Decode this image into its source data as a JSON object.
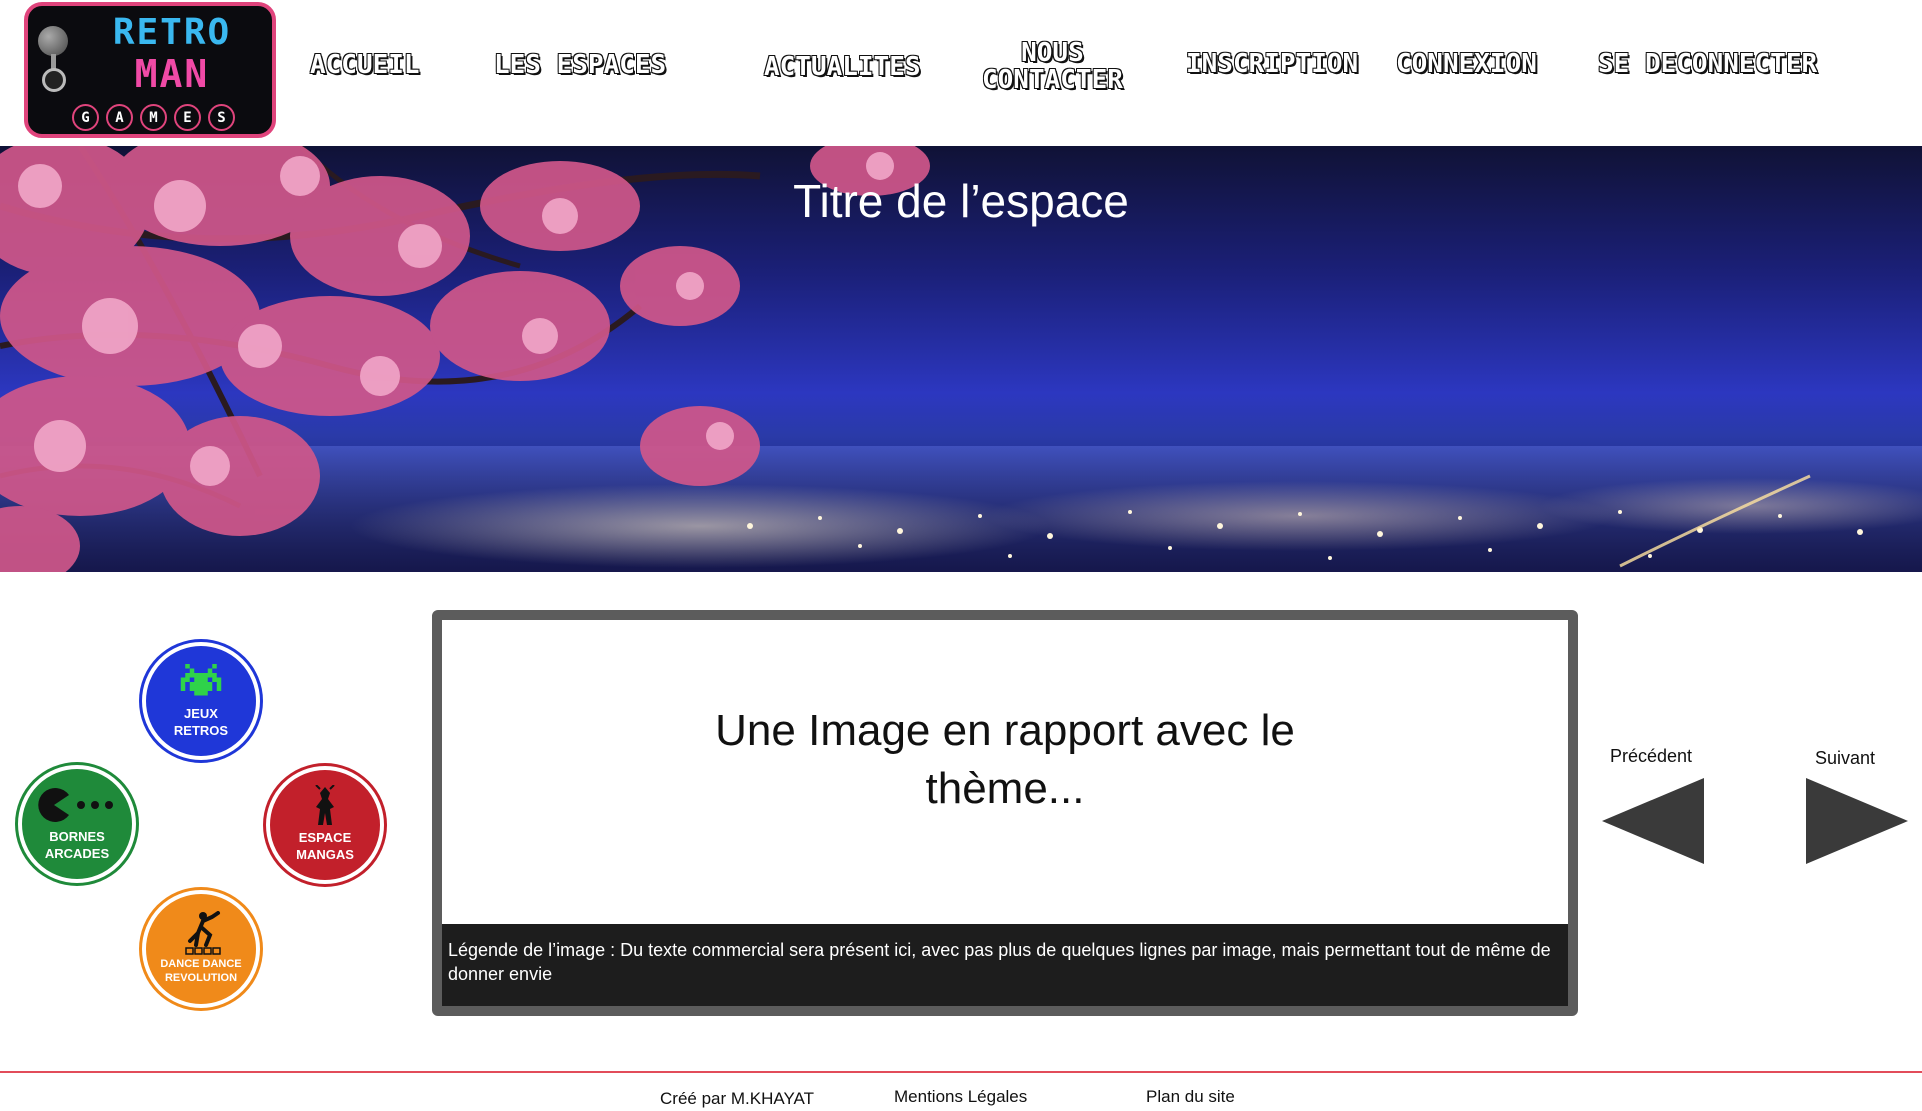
{
  "logo": {
    "line1": "RETRO",
    "line2": "MAN",
    "letters": [
      "G",
      "A",
      "M",
      "E",
      "S"
    ]
  },
  "nav": {
    "accueil": "ACCUEIL",
    "espaces": "LES ESPACES",
    "actualites": "ACTUALITES",
    "contact_line1": "NOUS",
    "contact_line2": "CONTACTER",
    "inscription": "INSCRIPTION",
    "connexion": "CONNEXION",
    "deconnecter": "SE DECONNECTER"
  },
  "banner": {
    "title": "Titre de l’espace"
  },
  "badges": {
    "jeux": {
      "line1": "JEUX",
      "line2": "RETROS",
      "color": "#1f37d8",
      "icon": "space-invader-icon"
    },
    "bornes": {
      "line1": "BORNES",
      "line2": "ARCADES",
      "color": "#1f8a3a",
      "icon": "pacman-icon"
    },
    "mangas": {
      "line1": "ESPACE",
      "line2": "MANGAS",
      "color": "#c2202b",
      "icon": "manga-character-icon"
    },
    "dance": {
      "line1": "DANCE DANCE",
      "line2": "REVOLUTION",
      "color": "#f08a1a",
      "icon": "dancer-icon"
    }
  },
  "carousel": {
    "image_text": "Une Image en rapport avec le thème...",
    "caption": "Légende de l’image :  Du texte commercial sera présent ici, avec pas plus de quelques lignes par image, mais permettant tout de même de donner envie",
    "prev_label": "Précédent",
    "next_label": "Suivant"
  },
  "footer": {
    "created_by": "Créé par M.KHAYAT",
    "legal": "Mentions Légales",
    "sitemap": "Plan du site"
  }
}
